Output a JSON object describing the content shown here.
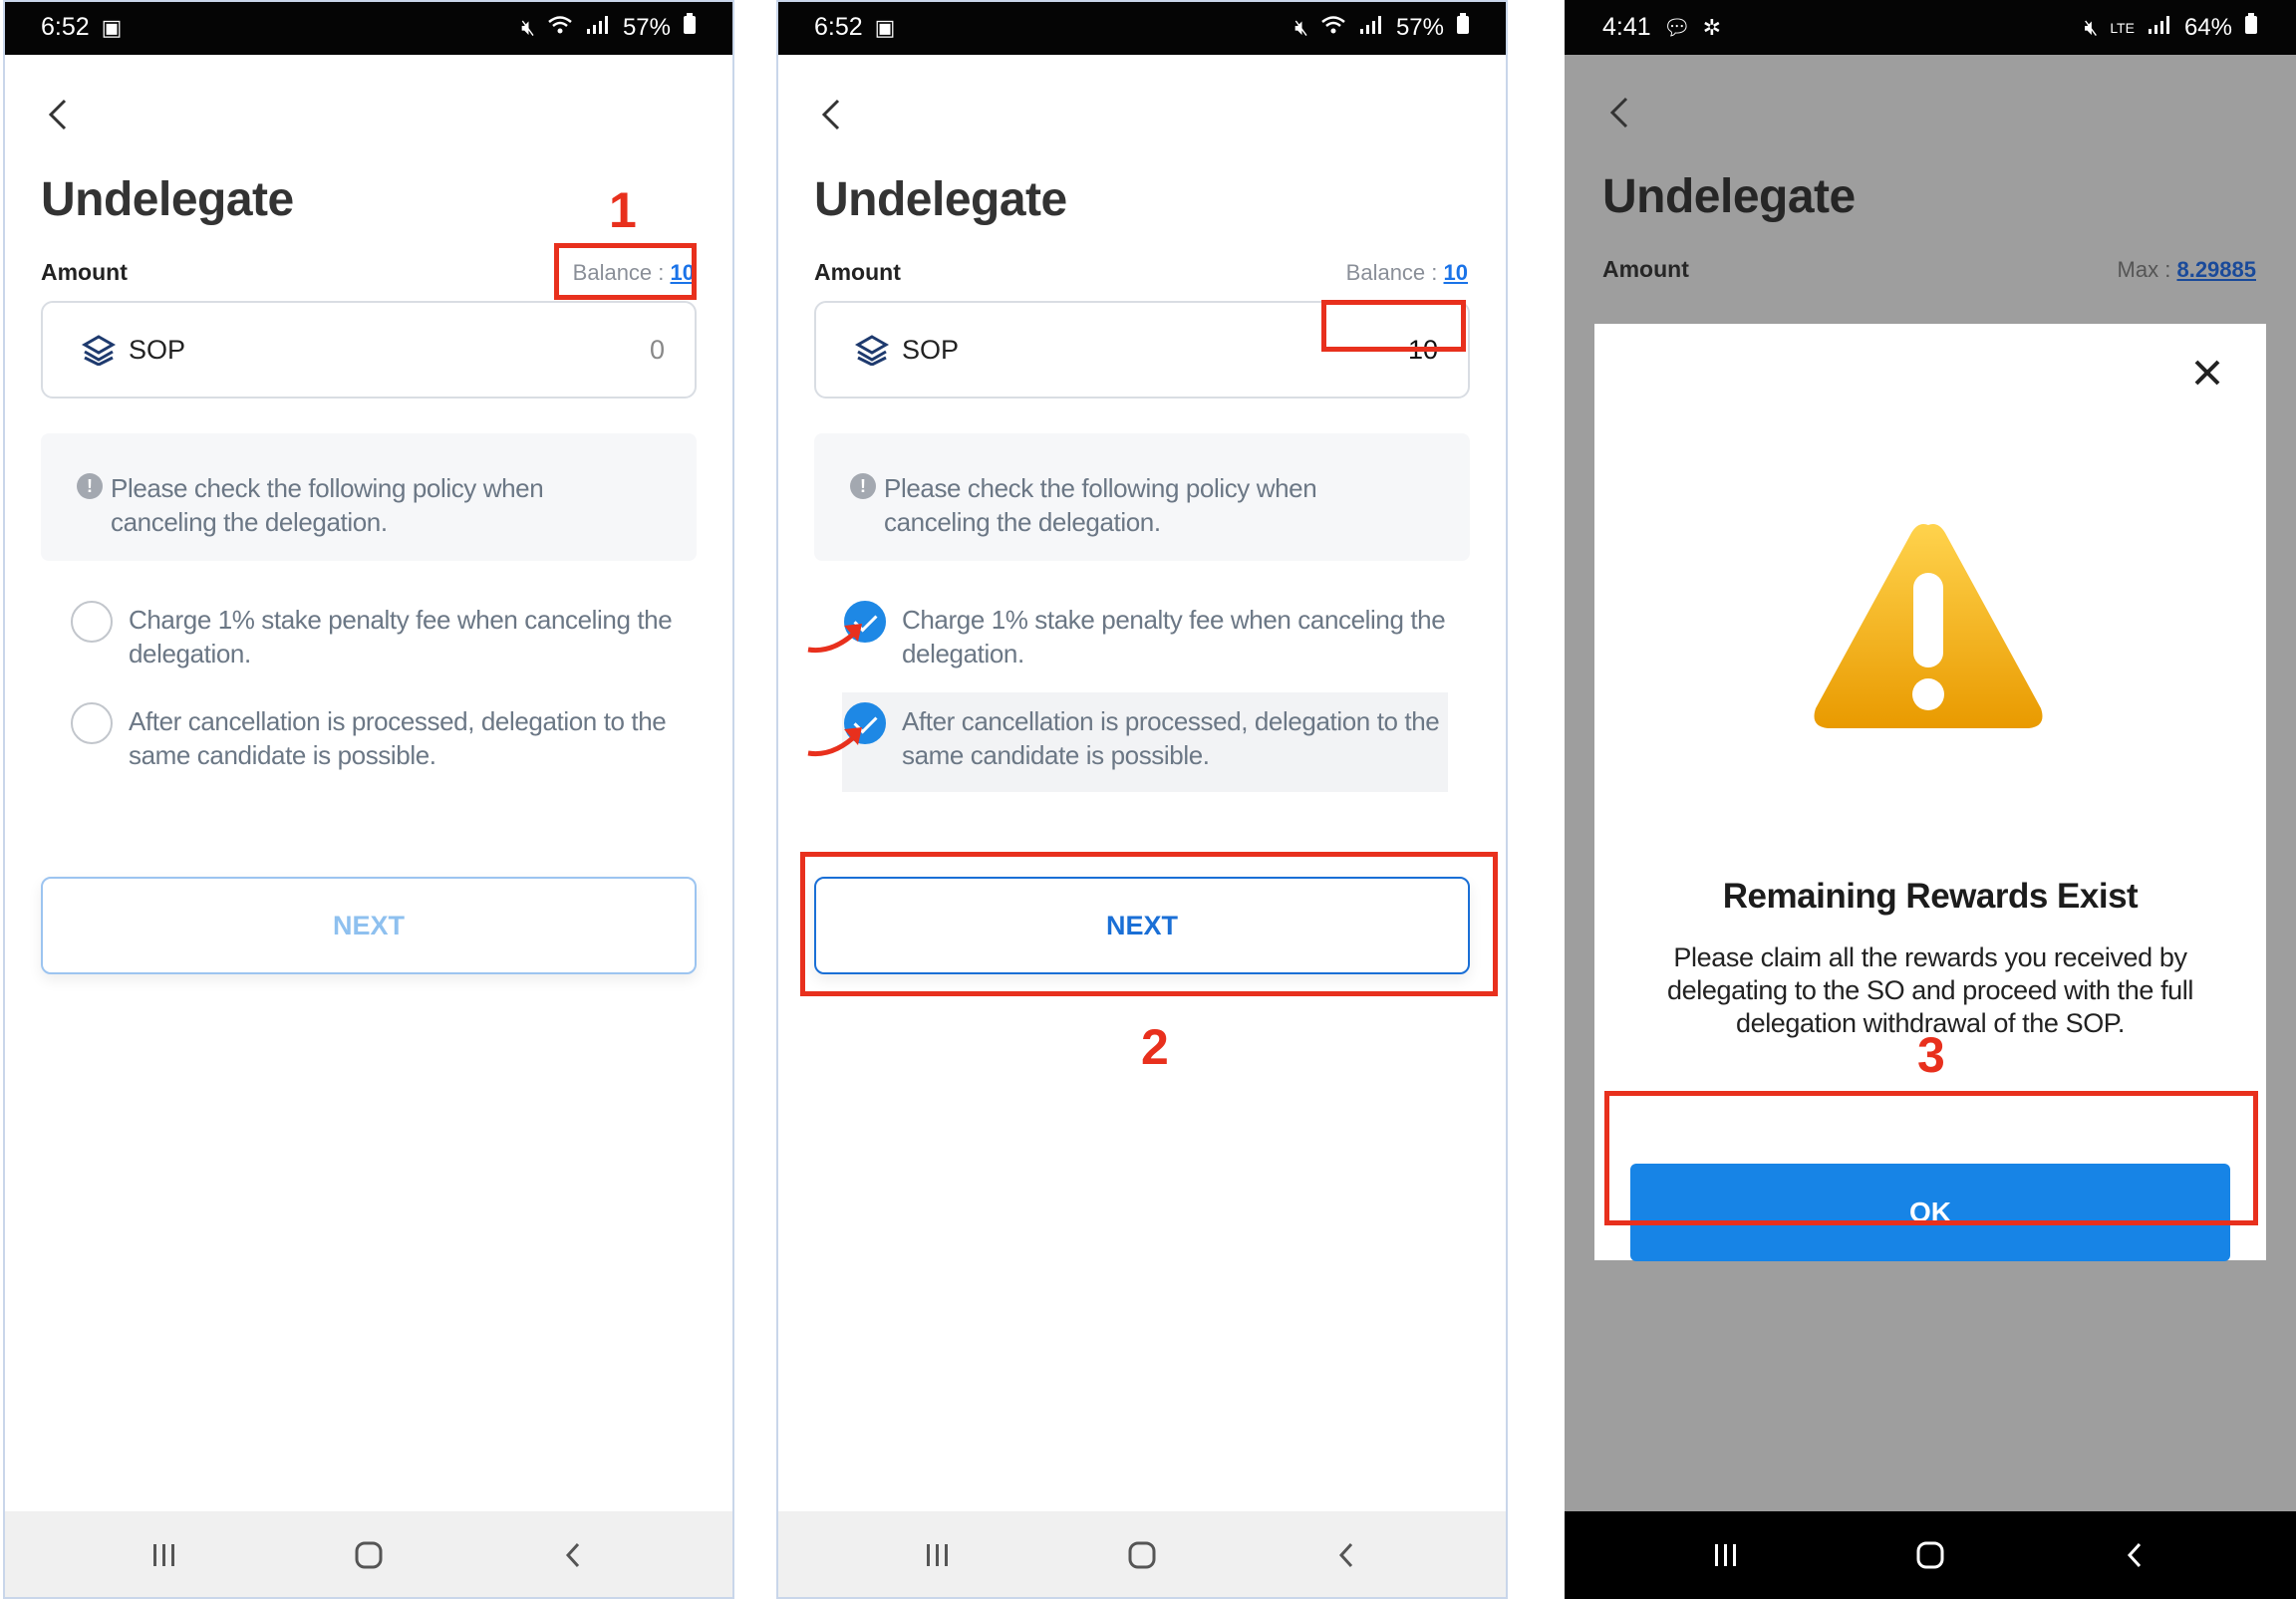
{
  "panels": [
    {
      "status": {
        "time": "6:52",
        "battery": "57%"
      },
      "title": "Undelegate",
      "amount_label": "Amount",
      "balance_label": "Balance :",
      "balance_value": "10",
      "coin": "SOP",
      "amount_value": "0",
      "policy_notice": "Please check the following policy when canceling the delegation.",
      "checks": [
        {
          "label": "Charge 1% stake penalty fee when canceling the delegation.",
          "checked": false
        },
        {
          "label": "After cancellation is processed, delegation to the same candidate is possible.",
          "checked": false
        }
      ],
      "next_label": "NEXT",
      "step": "1"
    },
    {
      "status": {
        "time": "6:52",
        "battery": "57%"
      },
      "title": "Undelegate",
      "amount_label": "Amount",
      "balance_label": "Balance :",
      "balance_value": "10",
      "coin": "SOP",
      "amount_value": "10",
      "policy_notice": "Please check the following policy when canceling the delegation.",
      "checks": [
        {
          "label": "Charge 1% stake penalty fee when canceling the delegation.",
          "checked": true
        },
        {
          "label": "After cancellation is processed, delegation to the same candidate is possible.",
          "checked": true
        }
      ],
      "next_label": "NEXT",
      "step": "2"
    },
    {
      "status": {
        "time": "4:41",
        "battery": "64%",
        "network": "LTE"
      },
      "title": "Undelegate",
      "amount_label": "Amount",
      "max_label": "Max :",
      "max_value": "8.29885",
      "modal": {
        "title": "Remaining Rewards Exist",
        "message": "Please claim all the rewards you received by delegating to the SO and proceed with the full delegation withdrawal of the SOP.",
        "ok_label": "OK"
      },
      "step": "3"
    }
  ],
  "colors": {
    "accent": "#1e88e5",
    "annotation_red": "#e8301d",
    "warning_yellow": "#f5b400"
  }
}
